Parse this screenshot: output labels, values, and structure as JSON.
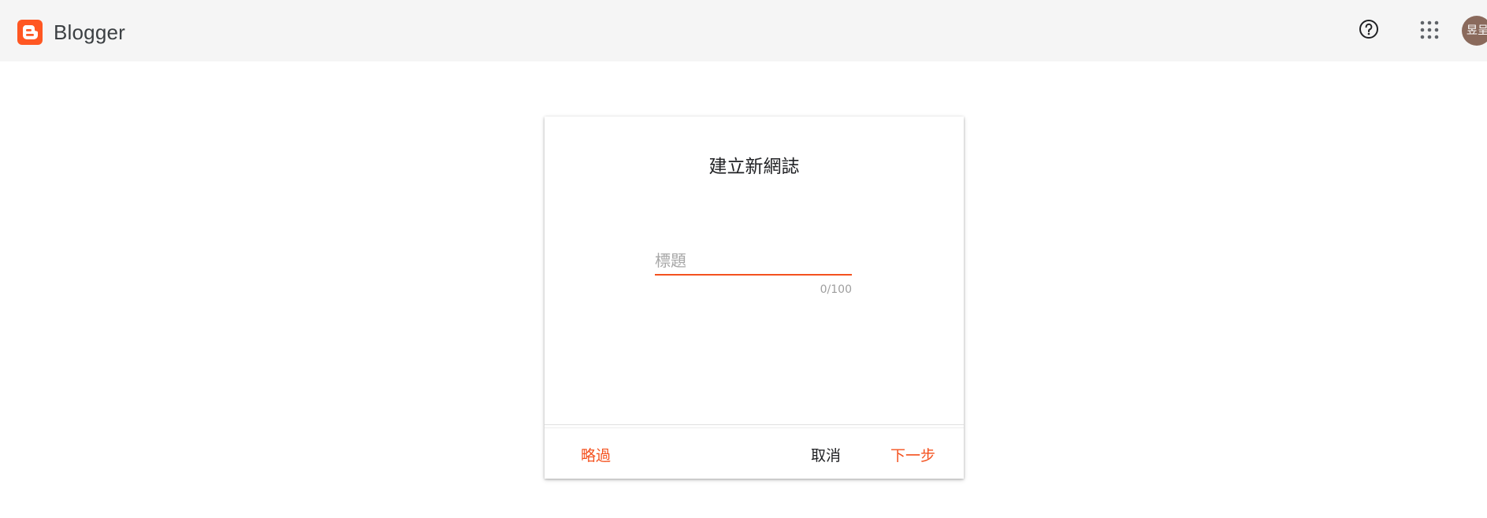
{
  "header": {
    "app_name": "Blogger",
    "avatar_text": "昱呈",
    "icons": {
      "logo": "blogger-logo-icon",
      "help": "help-circle-icon",
      "apps": "apps-grid-icon"
    },
    "colors": {
      "brand": "#ff5722",
      "bar_bg": "#f5f5f5"
    }
  },
  "dialog": {
    "title": "建立新網誌",
    "title_field": {
      "placeholder": "標題",
      "value": ""
    },
    "char_counter": "0/100",
    "buttons": {
      "skip": "略過",
      "cancel": "取消",
      "next": "下一步"
    },
    "colors": {
      "accent": "#f4511e"
    }
  }
}
